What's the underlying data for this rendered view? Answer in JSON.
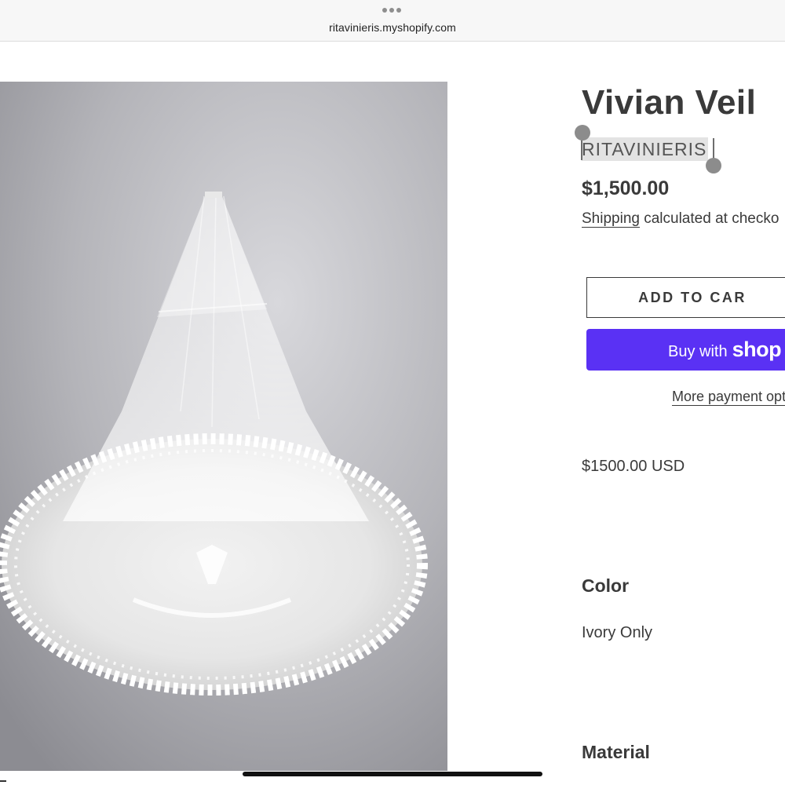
{
  "browser": {
    "url": "ritavinieris.myshopify.com"
  },
  "product": {
    "title": "Vivian Veil",
    "vendor": "RITAVINIERIS",
    "price": "$1,500.00",
    "shipping_link": "Shipping",
    "shipping_text": " calculated at checko",
    "add_to_cart": "ADD TO CAR",
    "buy_with": "Buy with",
    "shop_brand": "shop",
    "more_payment": "More payment opt",
    "usd_price": "$1500.00 USD",
    "color_heading": "Color",
    "color_value": "Ivory Only",
    "material_heading": "Material",
    "image_alt": "veil on mannequin photo"
  },
  "colors": {
    "shop_pay": "#5a31f4",
    "text": "#3a3a3a",
    "selection": "#e3e3e3"
  },
  "icons": {
    "browser_menu": "three-dots-icon",
    "selection_start": "selection-handle-icon",
    "selection_end": "selection-handle-icon"
  }
}
